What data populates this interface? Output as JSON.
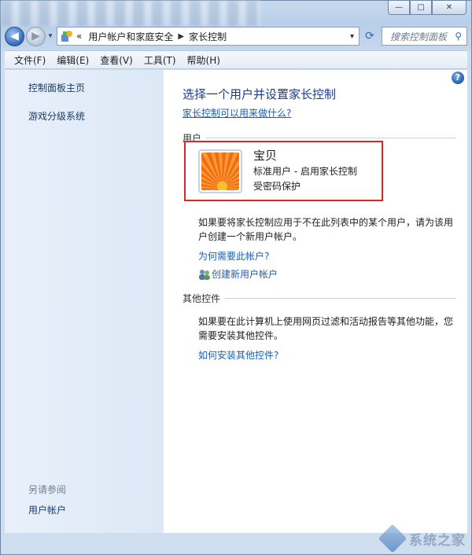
{
  "window": {
    "caption": {
      "minimize": "—",
      "maximize": "□",
      "close": "✕"
    }
  },
  "navbar": {
    "back_icon": "back-arrow-icon",
    "forward_icon": "forward-arrow-icon",
    "history_dropdown": "▾",
    "breadcrumb_prefix": "«",
    "breadcrumbs": [
      "用户帐户和家庭安全",
      "家长控制"
    ],
    "breadcrumb_separator": "▶",
    "address_dropdown": "▾",
    "refresh_glyph": "⟳",
    "search_placeholder": "搜索控制面板",
    "search_glyph": "⚲"
  },
  "menu": {
    "items": [
      "文件(F)",
      "编辑(E)",
      "查看(V)",
      "工具(T)",
      "帮助(H)"
    ]
  },
  "left_pane": {
    "tasks": [
      "控制面板主页",
      "游戏分级系统"
    ],
    "see_also_label": "另请参阅",
    "see_also_items": [
      "用户帐户"
    ]
  },
  "main": {
    "help_glyph": "?",
    "title": "选择一个用户并设置家长控制",
    "intro_link": "家长控制可以用来做什么?",
    "users_section_label": "用户",
    "user": {
      "name": "宝贝",
      "type": "标准用户 - 启用家长控制",
      "password_status": "受密码保护"
    },
    "new_user_paragraph": "如果要将家长控制应用于不在此列表中的某个用户，请为该用户创建一个新用户帐户。",
    "why_account_link": "为何需要此帐户?",
    "create_account_link": "创建新用户帐户",
    "other_controls_label": "其他控件",
    "other_controls_paragraph": "如果要在此计算机上使用网页过滤和活动报告等其他功能，您需要安装其他控件。",
    "install_controls_link": "如何安装其他控件?"
  },
  "watermark": {
    "text": "系统之家"
  },
  "colors": {
    "highlight_box": "#d7272b",
    "link": "#1a5fb4",
    "title": "#1e3a8a",
    "left_pane": "#e8f0fa"
  }
}
